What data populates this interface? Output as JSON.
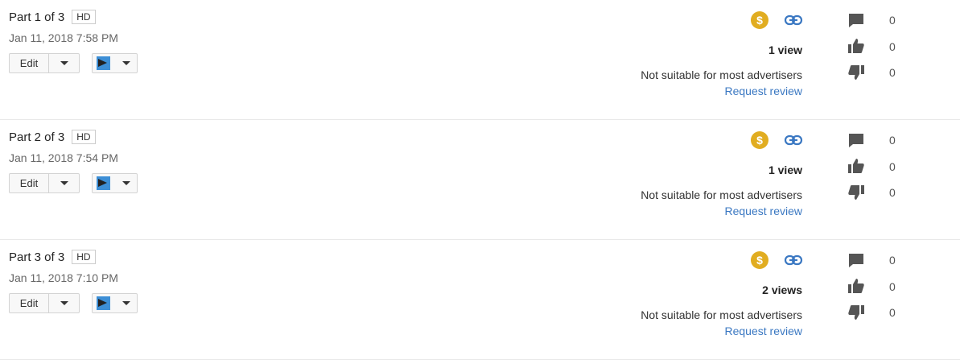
{
  "videos": [
    {
      "title": "Part 1 of 3",
      "quality_badge": "HD",
      "date": "Jan 11, 2018 7:58 PM",
      "edit_label": "Edit",
      "monetization_symbol": "$",
      "views": "1 view",
      "restriction": "Not suitable for most advertisers",
      "review_link": "Request review",
      "comments": "0",
      "likes": "0",
      "dislikes": "0"
    },
    {
      "title": "Part 2 of 3",
      "quality_badge": "HD",
      "date": "Jan 11, 2018 7:54 PM",
      "edit_label": "Edit",
      "monetization_symbol": "$",
      "views": "1 view",
      "restriction": "Not suitable for most advertisers",
      "review_link": "Request review",
      "comments": "0",
      "likes": "0",
      "dislikes": "0"
    },
    {
      "title": "Part 3 of 3",
      "quality_badge": "HD",
      "date": "Jan 11, 2018 7:10 PM",
      "edit_label": "Edit",
      "monetization_symbol": "$",
      "views": "2 views",
      "restriction": "Not suitable for most advertisers",
      "review_link": "Request review",
      "comments": "0",
      "likes": "0",
      "dislikes": "0"
    }
  ],
  "colors": {
    "monetization": "#e1ad21",
    "link": "#3b78c2",
    "icon_gray": "#555555"
  },
  "icons": [
    "dollar-icon",
    "link-icon",
    "comment-icon",
    "thumbs-up-icon",
    "thumbs-down-icon",
    "chevron-down-icon"
  ]
}
